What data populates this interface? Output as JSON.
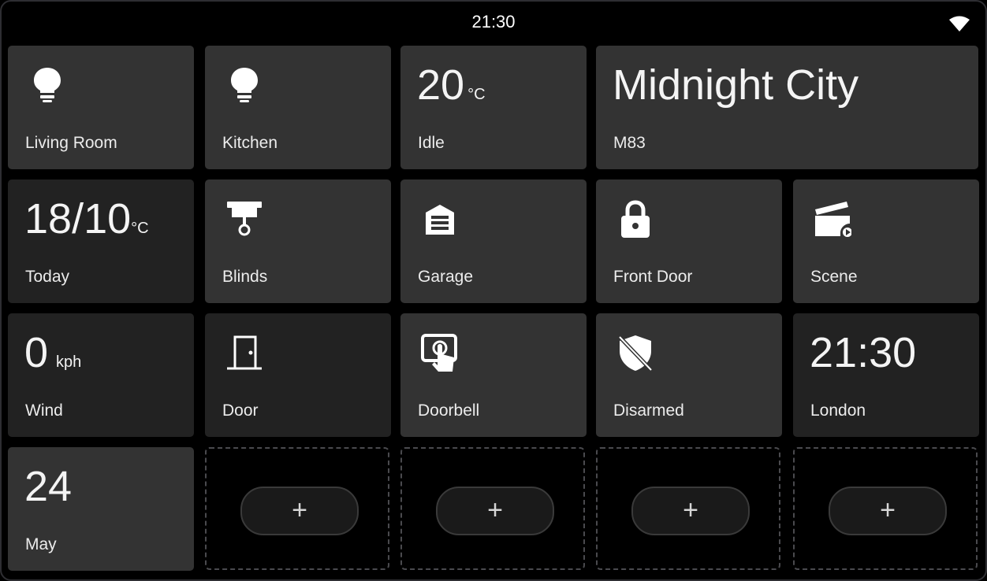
{
  "status": {
    "time": "21:30",
    "wifi_icon": "wifi-icon"
  },
  "tiles": {
    "living_room": {
      "label": "Living Room",
      "icon": "lightbulb-icon"
    },
    "kitchen": {
      "label": "Kitchen",
      "icon": "lightbulb-icon"
    },
    "thermostat": {
      "value": "20",
      "unit": "°C",
      "label": "Idle"
    },
    "media": {
      "title": "Midnight City",
      "artist": "M83"
    },
    "forecast": {
      "value": "18/10",
      "unit": "°C",
      "label": "Today"
    },
    "blinds": {
      "label": "Blinds",
      "icon": "blinds-icon"
    },
    "garage": {
      "label": "Garage",
      "icon": "garage-icon"
    },
    "front_door": {
      "label": "Front Door",
      "icon": "lock-icon"
    },
    "scene": {
      "label": "Scene",
      "icon": "clapperboard-icon"
    },
    "wind": {
      "value": "0",
      "unit": "kph",
      "label": "Wind"
    },
    "door": {
      "label": "Door",
      "icon": "door-icon"
    },
    "doorbell": {
      "label": "Doorbell",
      "icon": "doorbell-touch-icon"
    },
    "alarm": {
      "label": "Disarmed",
      "icon": "shield-off-icon"
    },
    "clock": {
      "value": "21:30",
      "label": "London"
    },
    "date": {
      "value": "24",
      "label": "May"
    }
  },
  "add_button": {
    "label": "+"
  },
  "colors": {
    "tile": "#333333",
    "tile_dim": "#222222",
    "background": "#000000",
    "text": "#ffffff"
  }
}
